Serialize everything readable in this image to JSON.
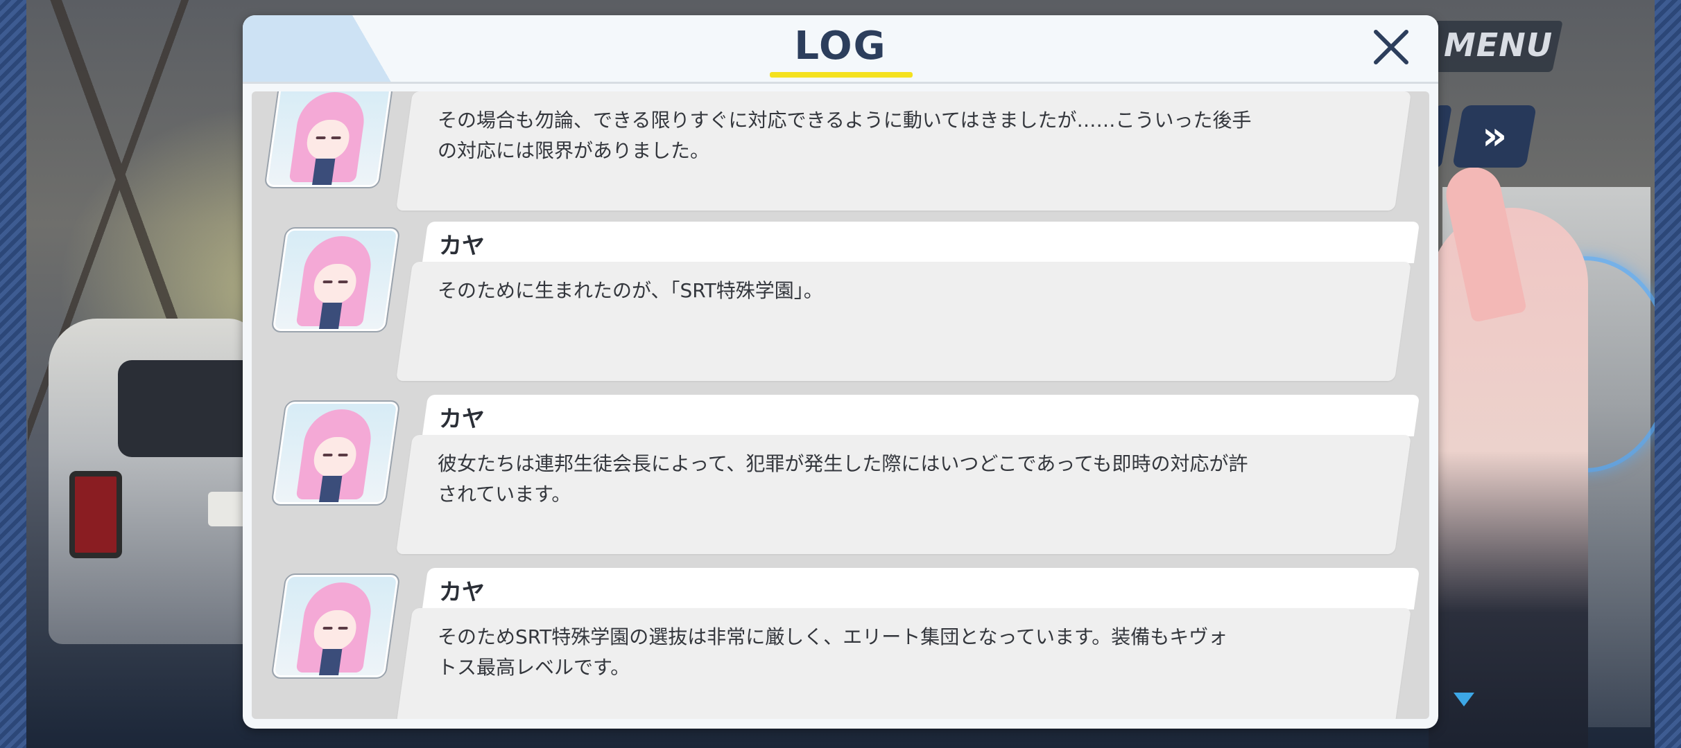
{
  "hud": {
    "menu_label": "MENU",
    "fast_forward_label": "»"
  },
  "log": {
    "title": "LOG",
    "entries": [
      {
        "speaker": "",
        "text": "その場合も勿論、できる限りすぐに対応できるように動いてはきましたが……こういった後手\nの対応には限界がありました。"
      },
      {
        "speaker": "カヤ",
        "text": "そのために生まれたのが、「SRT特殊学園」。"
      },
      {
        "speaker": "カヤ",
        "text": "彼女たちは連邦生徒会長によって、犯罪が発生した際にはいつどこであっても即時の対応が許\nされています。"
      },
      {
        "speaker": "カヤ",
        "text": "そのためSRT特殊学園の選抜は非常に厳しく、エリート集団となっています。装備もキヴォ\nトス最高レベルです。"
      }
    ]
  },
  "colors": {
    "accent_underline": "#f4e11e",
    "title_text": "#2c3e5c",
    "header_bg": "#f4f8fb",
    "bubble_bg": "#efefef"
  },
  "icons": [
    "close-icon",
    "fast-forward-icon",
    "menu-icon",
    "dropdown-triangle-icon"
  ]
}
